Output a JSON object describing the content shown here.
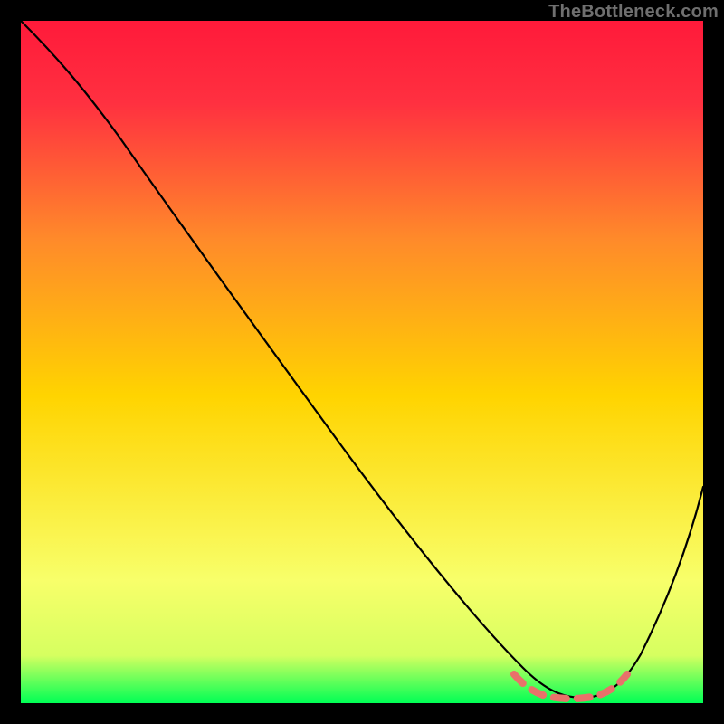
{
  "watermark": "TheBottleneck.com",
  "colors": {
    "page_bg": "#000000",
    "gradient_top": "#ff1a3a",
    "gradient_mid": "#ffd400",
    "gradient_straw": "#f8ff6a",
    "gradient_bottom": "#00ff55",
    "curve": "#000000",
    "dip_marker": "#e9716a"
  },
  "chart_data": {
    "type": "line",
    "title": "",
    "xlabel": "",
    "ylabel": "",
    "xlim": [
      0,
      100
    ],
    "ylim": [
      0,
      100
    ],
    "x": [
      0,
      4,
      8,
      12,
      16,
      20,
      24,
      28,
      32,
      36,
      40,
      44,
      48,
      52,
      56,
      60,
      64,
      68,
      72,
      76,
      80,
      84,
      88,
      92,
      96,
      100
    ],
    "values": [
      100,
      98,
      95,
      91,
      86,
      81,
      75,
      69,
      63,
      57,
      51,
      45,
      39,
      33,
      27,
      21,
      16,
      11,
      7,
      3,
      1,
      1,
      3,
      9,
      19,
      32
    ],
    "dip_region": {
      "x_start": 72,
      "x_end": 88,
      "y_min": 1,
      "y_max": 7,
      "x_samples": [
        72,
        74,
        76,
        78,
        80,
        82,
        84,
        86,
        88
      ],
      "y_samples": [
        7,
        5,
        3,
        2,
        1,
        1,
        1,
        2,
        3
      ]
    },
    "annotations": [],
    "legend": []
  }
}
